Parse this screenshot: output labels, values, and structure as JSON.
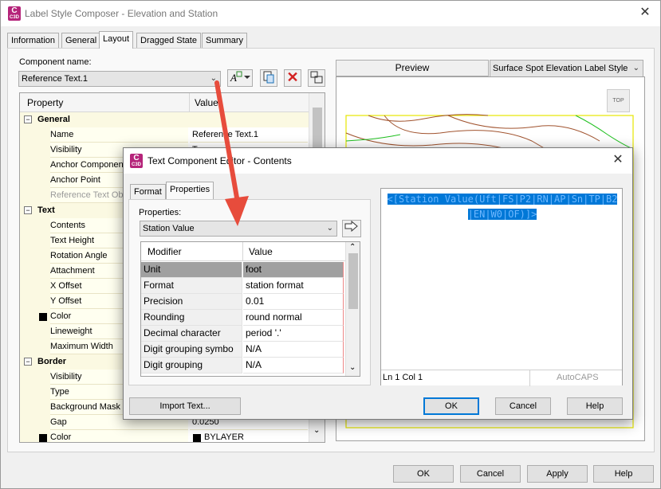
{
  "main_window": {
    "title": "Label Style Composer - Elevation and Station",
    "tabs": [
      "Information",
      "General",
      "Layout",
      "Dragged State",
      "Summary"
    ],
    "active_tab": "Layout",
    "component_name_label": "Component name:",
    "component_name_value": "Reference Text.1",
    "property_grid": {
      "col_property": "Property",
      "col_value": "Value",
      "categories": [
        {
          "name": "General",
          "rows": [
            {
              "name": "Name",
              "value": "Reference Text.1"
            },
            {
              "name": "Visibility",
              "value": "True"
            },
            {
              "name": "Anchor Component",
              "value": ""
            },
            {
              "name": "Anchor Point",
              "value": ""
            },
            {
              "name": "Reference Text Ob",
              "value": ""
            }
          ]
        },
        {
          "name": "Text",
          "rows": [
            {
              "name": "Contents",
              "value": ""
            },
            {
              "name": "Text Height",
              "value": ""
            },
            {
              "name": "Rotation Angle",
              "value": ""
            },
            {
              "name": "Attachment",
              "value": ""
            },
            {
              "name": "X Offset",
              "value": ""
            },
            {
              "name": "Y Offset",
              "value": ""
            },
            {
              "name": "Color",
              "value": ""
            },
            {
              "name": "Lineweight",
              "value": ""
            },
            {
              "name": "Maximum Width",
              "value": ""
            }
          ]
        },
        {
          "name": "Border",
          "rows": [
            {
              "name": "Visibility",
              "value": ""
            },
            {
              "name": "Type",
              "value": ""
            },
            {
              "name": "Background Mask",
              "value": ""
            },
            {
              "name": "Gap",
              "value": "0.0250"
            },
            {
              "name": "Color",
              "value": "BYLAYER"
            }
          ]
        }
      ]
    },
    "preview_label": "Preview",
    "preview_style": "Surface Spot Elevation Label Style",
    "view_cube_label": "TOP",
    "buttons": {
      "ok": "OK",
      "cancel": "Cancel",
      "apply": "Apply",
      "help": "Help"
    }
  },
  "editor_dialog": {
    "title": "Text Component Editor - Contents",
    "tabs": [
      "Format",
      "Properties"
    ],
    "active_tab": "Properties",
    "properties_label": "Properties:",
    "properties_value": "Station Value",
    "table": {
      "col_modifier": "Modifier",
      "col_value": "Value",
      "rows": [
        {
          "modifier": "Unit",
          "value": "foot"
        },
        {
          "modifier": "Format",
          "value": "station format"
        },
        {
          "modifier": "Precision",
          "value": "0.01"
        },
        {
          "modifier": "Rounding",
          "value": "round normal"
        },
        {
          "modifier": "Decimal character",
          "value": "period '.'"
        },
        {
          "modifier": "Digit grouping symbo",
          "value": "N/A"
        },
        {
          "modifier": "Digit grouping",
          "value": "N/A"
        }
      ]
    },
    "editor_text_line1": "<[Station  Value(Uft|FS|P2|RN|AP|Sn|TP|B2",
    "editor_text_line2": "|EN|W0|OF)]>",
    "status_position": "Ln 1 Col 1",
    "status_mode": "AutoCAPS",
    "buttons": {
      "import": "Import Text...",
      "ok": "OK",
      "cancel": "Cancel",
      "help": "Help"
    }
  },
  "colors": {
    "accent": "#0078d7",
    "text_highlight": "#0078d7",
    "arrow": "#e74c3c",
    "icon_magenta": "#b5247a"
  }
}
